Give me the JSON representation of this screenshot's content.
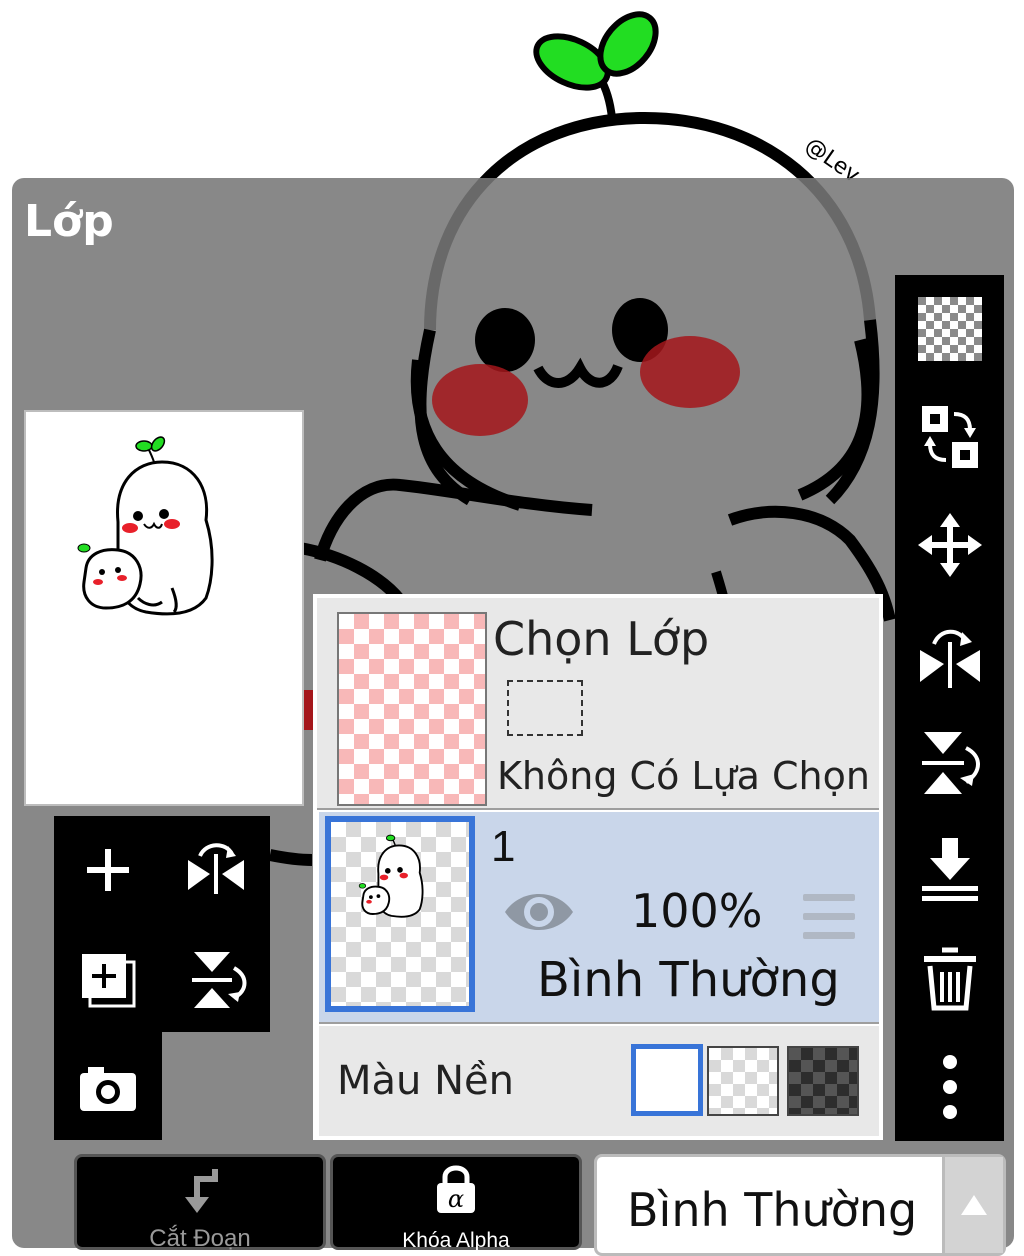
{
  "canvas_signature": "@Lev",
  "panel": {
    "title": "Lớp"
  },
  "selection_layer": {
    "title": "Chọn Lớp",
    "status": "Không Có Lựa Chọn"
  },
  "layer": {
    "number": "1",
    "visible": true,
    "opacity": "100%",
    "blend_mode": "Bình Thường"
  },
  "background": {
    "label": "Màu Nền",
    "options": [
      "white",
      "transparent-light",
      "transparent-dark"
    ],
    "selected": "white"
  },
  "left_tools": [
    "add-layer-icon",
    "flip-horizontal-icon",
    "add-copy-layer-icon",
    "flip-vertical-icon",
    "camera-icon"
  ],
  "right_tools": [
    "transparency-icon",
    "swap-layers-icon",
    "move-icon",
    "flip-horizontal-icon",
    "flip-vertical-icon",
    "merge-down-icon",
    "trash-icon",
    "more-vertical-icon"
  ],
  "bottom_bar": {
    "clip_label": "Cắt Đoạn",
    "alpha_lock_label": "Khóa Alpha",
    "blend_select_value": "Bình Thường"
  },
  "colors": {
    "accent": "#3874d8",
    "sprout": "#22dd22",
    "blush": "#e8202a"
  }
}
